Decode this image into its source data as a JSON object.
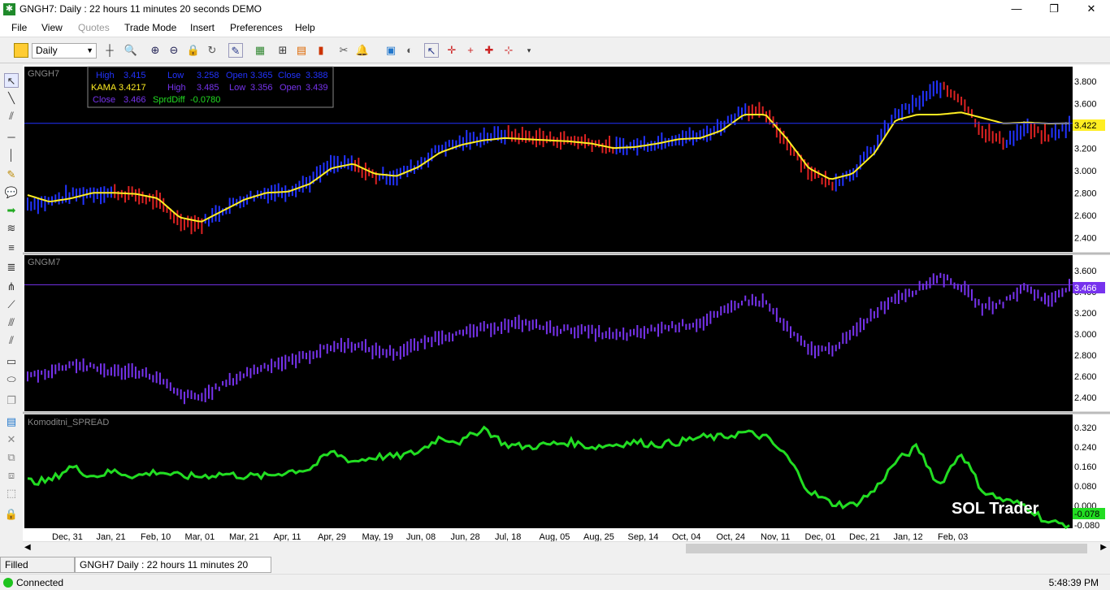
{
  "window": {
    "title": "GNGH7: Daily : 22 hours 11 minutes 20 seconds DEMO",
    "minimize": "—",
    "maximize": "❐",
    "close": "✕"
  },
  "menu": [
    "File",
    "View",
    "Quotes",
    "Trade Mode",
    "Insert",
    "Preferences",
    "Help"
  ],
  "toolbar": {
    "timeframe": "Daily"
  },
  "chart": {
    "pane1_label": "GNGH7",
    "pane2_label": "GNGM7",
    "pane3_label": "Komoditni_SPREAD",
    "watermark": "SOL Trader",
    "data_window": {
      "r1": [
        "High",
        "3.415",
        "Low",
        "3.258",
        "Open",
        "3.365",
        "Close",
        "3.388"
      ],
      "r2": [
        "KAMA",
        "3.4217",
        "High",
        "3.485",
        "Low",
        "3.356",
        "Open",
        "3.439"
      ],
      "r3": [
        "Close",
        "3.466",
        "SprdDiff",
        "-0.0780"
      ]
    },
    "price_tag_1": "3.422",
    "price_tag_2": "3.466",
    "price_tag_3": "-0.078",
    "colors": {
      "up": "#2233ff",
      "down": "#dd2222",
      "kama": "#ffee22",
      "gngm": "#7733ee",
      "spread": "#22dd22"
    }
  },
  "chart_data": [
    {
      "type": "line",
      "title": "GNGH7",
      "ylim": [
        2.3,
        3.9
      ],
      "y_ticks": [
        "3.800",
        "3.600",
        "3.400",
        "3.200",
        "3.000",
        "2.800",
        "2.600",
        "2.400"
      ],
      "x_ticks": [
        "Dec, 31",
        "Jan, 21",
        "Feb, 10",
        "Mar, 01",
        "Mar, 21",
        "Apr, 11",
        "Apr, 29",
        "May, 19",
        "Jun, 08",
        "Jun, 28",
        "Jul, 18",
        "Aug, 05",
        "Aug, 25",
        "Sep, 14",
        "Oct, 04",
        "Oct, 24",
        "Nov, 11",
        "Dec, 01",
        "Dec, 21",
        "Jan, 12",
        "Feb, 03"
      ],
      "series": [
        {
          "name": "GNGH7",
          "values": [
            2.7,
            2.72,
            2.78,
            2.8,
            2.8,
            2.78,
            2.72,
            2.55,
            2.52,
            2.65,
            2.75,
            2.8,
            2.82,
            2.9,
            3.05,
            3.05,
            2.95,
            2.95,
            3.05,
            3.2,
            3.25,
            3.3,
            3.32,
            3.3,
            3.28,
            3.27,
            3.25,
            3.2,
            3.22,
            3.25,
            3.3,
            3.3,
            3.4,
            3.55,
            3.5,
            3.25,
            3.0,
            2.88,
            2.98,
            3.2,
            3.5,
            3.6,
            3.75,
            3.65,
            3.35,
            3.25,
            3.38,
            3.3,
            3.4
          ]
        },
        {
          "name": "KAMA",
          "values": [
            2.78,
            2.72,
            2.75,
            2.8,
            2.8,
            2.79,
            2.75,
            2.58,
            2.54,
            2.64,
            2.74,
            2.8,
            2.81,
            2.88,
            3.02,
            3.06,
            2.97,
            2.95,
            3.03,
            3.16,
            3.23,
            3.27,
            3.29,
            3.28,
            3.27,
            3.26,
            3.24,
            3.2,
            3.21,
            3.24,
            3.28,
            3.29,
            3.36,
            3.5,
            3.5,
            3.28,
            3.02,
            2.92,
            2.97,
            3.15,
            3.45,
            3.5,
            3.5,
            3.52,
            3.47,
            3.42,
            3.43,
            3.42,
            3.4217
          ]
        }
      ]
    },
    {
      "type": "line",
      "title": "GNGM7",
      "ylim": [
        2.3,
        3.7
      ],
      "y_ticks": [
        "3.600",
        "3.400",
        "3.200",
        "3.000",
        "2.800",
        "2.600",
        "2.400"
      ],
      "series": [
        {
          "name": "GNGM7",
          "values": [
            2.6,
            2.64,
            2.72,
            2.68,
            2.64,
            2.65,
            2.58,
            2.42,
            2.4,
            2.52,
            2.62,
            2.7,
            2.74,
            2.8,
            2.88,
            2.9,
            2.84,
            2.82,
            2.9,
            2.98,
            3.0,
            3.05,
            3.08,
            3.1,
            3.05,
            3.04,
            3.02,
            2.98,
            3.0,
            3.05,
            3.08,
            3.1,
            3.2,
            3.32,
            3.3,
            3.05,
            2.85,
            2.85,
            3.0,
            3.2,
            3.35,
            3.42,
            3.55,
            3.45,
            3.25,
            3.3,
            3.45,
            3.3,
            3.466
          ]
        }
      ]
    },
    {
      "type": "line",
      "title": "Komoditni_SPREAD",
      "ylim": [
        -0.08,
        0.34
      ],
      "y_ticks": [
        "0.320",
        "0.240",
        "0.160",
        "0.080",
        "0.000",
        "-0.080"
      ],
      "series": [
        {
          "name": "SprdDiff",
          "values": [
            0.1,
            0.1,
            0.16,
            0.12,
            0.14,
            0.12,
            0.14,
            0.12,
            0.12,
            0.13,
            0.12,
            0.12,
            0.14,
            0.15,
            0.22,
            0.18,
            0.2,
            0.2,
            0.22,
            0.28,
            0.26,
            0.32,
            0.25,
            0.24,
            0.25,
            0.26,
            0.24,
            0.25,
            0.26,
            0.25,
            0.26,
            0.28,
            0.28,
            0.3,
            0.28,
            0.2,
            0.06,
            0.01,
            0.0,
            0.06,
            0.18,
            0.24,
            0.08,
            0.22,
            0.06,
            0.02,
            0.0,
            -0.07,
            -0.078
          ]
        }
      ]
    }
  ]
}
